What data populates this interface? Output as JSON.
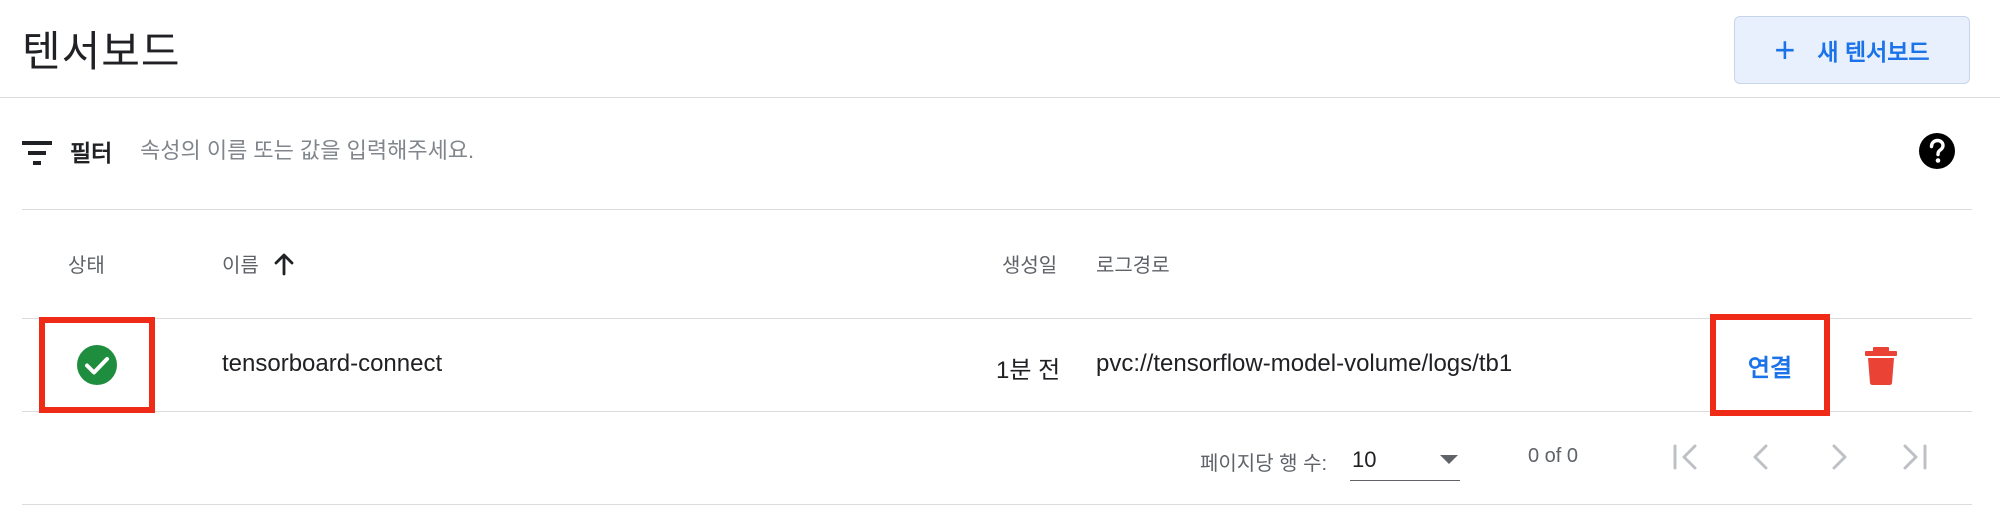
{
  "header": {
    "title": "텐서보드",
    "new_button": {
      "icon": "plus-icon",
      "label": "새 텐서보드"
    }
  },
  "filter": {
    "icon": "filter-icon",
    "label": "필터",
    "placeholder": "속성의 이름 또는 값을 입력해주세요.",
    "help_icon": "help-icon"
  },
  "table": {
    "columns": {
      "status": "상태",
      "name": "이름",
      "created": "생성일",
      "logpath": "로그경로"
    },
    "sort": {
      "column": "name",
      "direction": "ascending",
      "icon": "arrow-up-icon"
    },
    "rows": [
      {
        "status": "ready",
        "status_icon": "check-circle-icon",
        "name": "tensorboard-connect",
        "created": "1분 전",
        "logpath": "pvc://tensorflow-model-volume/logs/tb1",
        "connect_label": "연결",
        "delete_icon": "trash-icon"
      }
    ]
  },
  "paginator": {
    "per_page_label": "페이지당 행 수:",
    "per_page_value": "10",
    "range_label": "0 of 0"
  },
  "colors": {
    "accent": "#1a73e8",
    "success": "#1e8e3e",
    "danger": "#ea4335",
    "highlight": "#ef2b18"
  }
}
